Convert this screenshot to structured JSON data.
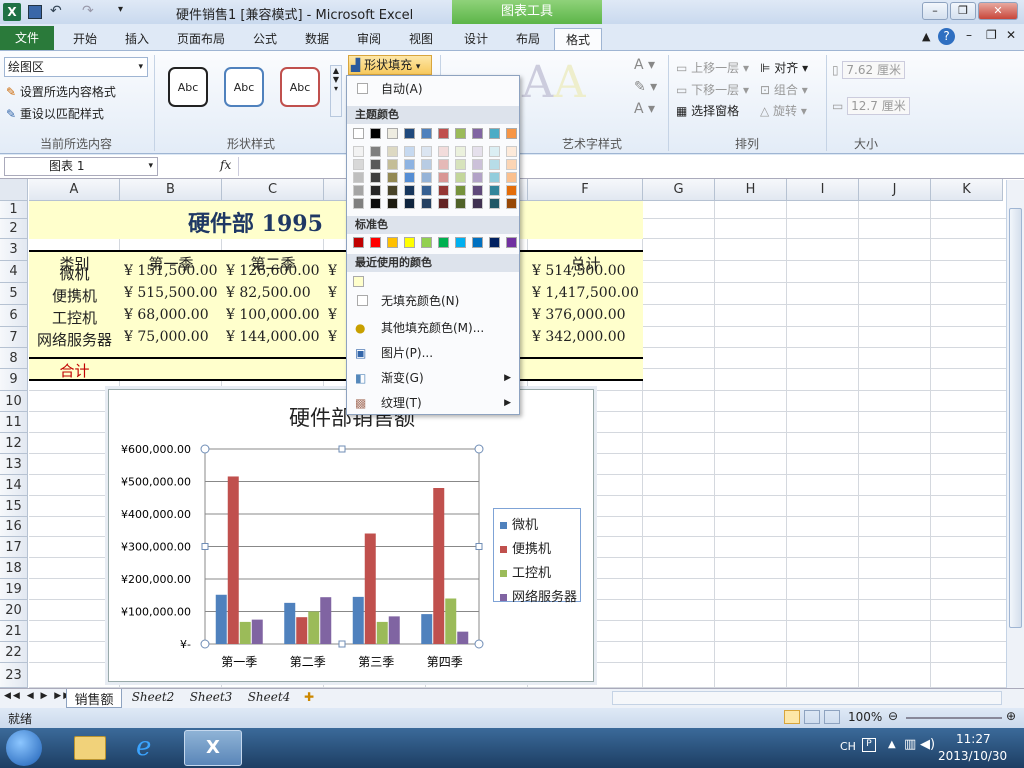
{
  "title": {
    "text": "硬件销售1  [兼容模式]  -  Microsoft Excel",
    "chart_tools": "图表工具"
  },
  "qat": {
    "save_icon": "save-icon",
    "undo_icon": "undo-icon",
    "redo_icon": "redo-icon"
  },
  "window_controls": {
    "minimize": "–",
    "restore": "❐",
    "close": "✕"
  },
  "tabs": [
    "文件",
    "开始",
    "插入",
    "页面布局",
    "公式",
    "数据",
    "审阅",
    "视图",
    "设计",
    "布局",
    "格式"
  ],
  "ribbon": {
    "selection_box": "绘图区",
    "format_selection": "设置所选内容格式",
    "reset_style": "重设以匹配样式",
    "group_current": "当前所选内容",
    "abc": [
      "Abc",
      "Abc",
      "Abc"
    ],
    "group_shape_styles": "形状样式",
    "shape_fill": "形状填充",
    "group_wordart": "艺术字样式",
    "bring_forward": "上移一层",
    "send_backward": "下移一层",
    "selection_pane": "选择窗格",
    "align": "对齐",
    "group": "组合",
    "rotate": "旋转",
    "group_arrange": "排列",
    "height": "7.62 厘米",
    "width": "12.7 厘米",
    "group_size": "大小"
  },
  "formula": {
    "name_box": "图表 1",
    "fx": "fx"
  },
  "columns": [
    "A",
    "B",
    "C",
    "D",
    "E",
    "F",
    "G",
    "H",
    "I",
    "J",
    "K"
  ],
  "rows": [
    "1",
    "2",
    "3",
    "4",
    "5",
    "6",
    "7",
    "8",
    "9",
    "10",
    "11",
    "12",
    "13",
    "14",
    "15",
    "16",
    "17",
    "18",
    "19",
    "20",
    "21",
    "22",
    "23"
  ],
  "sheet": {
    "title": "硬件部 1995",
    "headers": [
      "类别",
      "第一季",
      "第二季",
      "总计"
    ],
    "rows": [
      {
        "cat": "微机",
        "q1": "¥  151,500.00",
        "q2": "¥  126,600.00",
        "d": "¥",
        "total": "¥      514,500.00"
      },
      {
        "cat": "便携机",
        "q1": "¥  515,500.00",
        "q2": "¥    82,500.00",
        "d": "¥",
        "total": "¥  1,417,500.00"
      },
      {
        "cat": "工控机",
        "q1": "¥    68,000.00",
        "q2": "¥  100,000.00",
        "d": "¥",
        "total": "¥      376,000.00"
      },
      {
        "cat": "网络服务器",
        "q1": "¥    75,000.00",
        "q2": "¥  144,000.00",
        "d": "¥",
        "total": "¥      342,000.00"
      }
    ],
    "sum_label": "合计"
  },
  "menu": {
    "auto": "自动(A)",
    "theme_colors": "主题颜色",
    "standard_colors": "标准色",
    "recent_colors": "最近使用的颜色",
    "no_fill": "无填充颜色(N)",
    "more_colors": "其他填充颜色(M)...",
    "picture": "图片(P)...",
    "gradient": "渐变(G)",
    "texture": "纹理(T)",
    "theme_row": [
      "#ffffff",
      "#000000",
      "#eeece1",
      "#1f497d",
      "#4f81bd",
      "#c0504d",
      "#9bbb59",
      "#8064a2",
      "#4bacc6",
      "#f79646"
    ],
    "theme_shades": [
      [
        "#f2f2f2",
        "#7f7f7f",
        "#ddd9c3",
        "#c6d9f0",
        "#dbe5f1",
        "#f2dcdb",
        "#ebf1dd",
        "#e5e0ec",
        "#dbeef3",
        "#fdeada"
      ],
      [
        "#d8d8d8",
        "#595959",
        "#c4bd97",
        "#8db3e2",
        "#b8cce4",
        "#e5b9b7",
        "#d7e3bc",
        "#ccc1d9",
        "#b7dde8",
        "#fbd5b5"
      ],
      [
        "#bfbfbf",
        "#3f3f3f",
        "#938953",
        "#548dd4",
        "#95b3d7",
        "#d99694",
        "#c3d69b",
        "#b2a2c7",
        "#92cddc",
        "#fac08f"
      ],
      [
        "#a5a5a5",
        "#262626",
        "#494429",
        "#17365d",
        "#366092",
        "#953734",
        "#76923c",
        "#5f497a",
        "#31859b",
        "#e36c09"
      ],
      [
        "#7f7f7f",
        "#0c0c0c",
        "#1d1b10",
        "#0f243e",
        "#244061",
        "#632423",
        "#4f6128",
        "#3f3151",
        "#205867",
        "#974806"
      ]
    ],
    "standard_row": [
      "#c00000",
      "#ff0000",
      "#ffc000",
      "#ffff00",
      "#92d050",
      "#00b050",
      "#00b0f0",
      "#0070c0",
      "#002060",
      "#7030a0"
    ],
    "recent_row": [
      "#ffffcc"
    ]
  },
  "sheet_tabs": [
    "销售额",
    "Sheet2",
    "Sheet3",
    "Sheet4"
  ],
  "status": {
    "ready": "就绪",
    "zoom": "100%"
  },
  "taskbar": {
    "lang": "CH",
    "time": "11:27",
    "date": "2013/10/30"
  },
  "chart_data": {
    "type": "bar",
    "title": "硬件部销售额",
    "categories": [
      "第一季",
      "第二季",
      "第三季",
      "第四季"
    ],
    "series": [
      {
        "name": "微机",
        "color": "#4f81bd",
        "values": [
          151500,
          126600,
          145000,
          92000
        ]
      },
      {
        "name": "便携机",
        "color": "#c0504d",
        "values": [
          515500,
          82500,
          340000,
          480000
        ]
      },
      {
        "name": "工控机",
        "color": "#9bbb59",
        "values": [
          68000,
          100000,
          68000,
          140000
        ]
      },
      {
        "name": "网络服务器",
        "color": "#8064a2",
        "values": [
          75000,
          144000,
          85000,
          38000
        ]
      }
    ],
    "yticks": [
      "¥600,000.00",
      "¥500,000.00",
      "¥400,000.00",
      "¥300,000.00",
      "¥200,000.00",
      "¥100,000.00",
      "¥-"
    ],
    "ylim": [
      0,
      600000
    ],
    "legend": "right",
    "grid": true
  }
}
